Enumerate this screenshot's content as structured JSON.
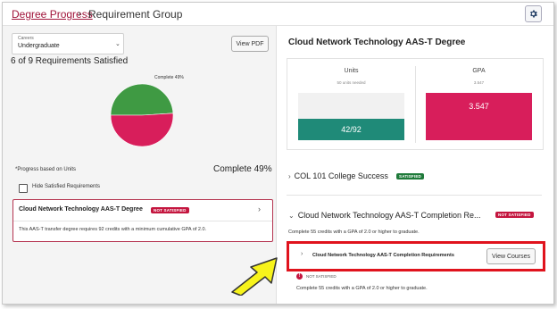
{
  "header": {
    "breadcrumb_link": "Degree Progress",
    "breadcrumb_sep": "›",
    "breadcrumb_current": "Requirement Group"
  },
  "left": {
    "select": {
      "label": "Careers",
      "value": "Undergraduate"
    },
    "view_pdf": "View PDF",
    "summary": "6 of 9 Requirements Satisfied",
    "pie_label": "Complete 49%",
    "chart_data": {
      "type": "pie",
      "values": [
        49,
        51
      ],
      "colors": [
        "#3f9a43",
        "#d81e5b"
      ]
    },
    "progress_note": "*Progress based on Units",
    "complete_text": "Complete 49%",
    "hide_satisfied": "Hide Satisfied Requirements",
    "card": {
      "title": "Cloud Network Technology AAS-T Degree",
      "badge": "NOT SATISFIED",
      "description": "This AAS-T transfer degree requires 92 credits with a minimum cumulative GPA of 2.0."
    }
  },
  "right": {
    "title": "Cloud Network Technology AAS-T Degree",
    "units": {
      "header": "Units",
      "sub": "50 units needed",
      "value": "42/92",
      "fraction": 0.4565
    },
    "gpa": {
      "header": "GPA",
      "sub": "3.547",
      "value": "3.547"
    },
    "col101": {
      "title": "COL 101 College Success",
      "badge": "SATISFIED"
    },
    "completion": {
      "title": "Cloud Network Technology AAS-T Completion Re...",
      "badge": "NOT SATISFIED",
      "description": "Complete 55 credits with a GPA of 2.0 or higher to graduate."
    },
    "requirement": {
      "title": "Cloud Network Technology AAS-T Completion Requirements",
      "button": "View Courses",
      "status": "NOT SATISFIED",
      "description": "Complete 55 credits with a GPA of 2.0 or higher to graduate."
    }
  },
  "icons": {
    "settings": "gear-icon",
    "chevron": "chevron-right-icon",
    "dropdown": "chevron-down-icon",
    "annotation_arrow": "arrow-icon",
    "status": "exclamation-icon"
  },
  "colors": {
    "accent": "#a0143a",
    "not_satisfied": "#c4163f",
    "satisfied": "#1f7a3a",
    "units_fill": "#1f8a78",
    "gpa_fill": "#d81e5b",
    "pie_green": "#3f9a43",
    "highlight": "#e0131d",
    "arrow": "#f7f31b"
  }
}
